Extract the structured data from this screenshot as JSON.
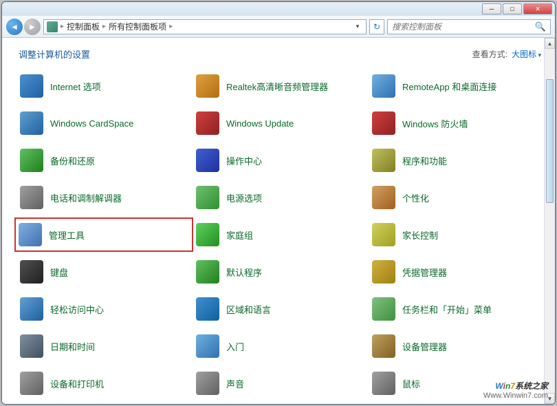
{
  "breadcrumb": {
    "root": "控制面板",
    "current": "所有控制面板项"
  },
  "search": {
    "placeholder": "搜索控制面板"
  },
  "page_title": "调整计算机的设置",
  "view_by_label": "查看方式:",
  "view_by_value": "大图标",
  "items": [
    {
      "label": "Internet 选项",
      "icon": "internet-options-icon",
      "cls": "ico1"
    },
    {
      "label": "Realtek高清晰音频管理器",
      "icon": "realtek-audio-icon",
      "cls": "ico2"
    },
    {
      "label": "RemoteApp 和桌面连接",
      "icon": "remoteapp-icon",
      "cls": "ico3"
    },
    {
      "label": "Windows CardSpace",
      "icon": "cardspace-icon",
      "cls": "ico4"
    },
    {
      "label": "Windows Update",
      "icon": "windows-update-icon",
      "cls": "ico5"
    },
    {
      "label": "Windows 防火墙",
      "icon": "firewall-icon",
      "cls": "ico5"
    },
    {
      "label": "备份和还原",
      "icon": "backup-restore-icon",
      "cls": "ico6"
    },
    {
      "label": "操作中心",
      "icon": "action-center-icon",
      "cls": "ico7"
    },
    {
      "label": "程序和功能",
      "icon": "programs-features-icon",
      "cls": "ico8"
    },
    {
      "label": "电话和调制解调器",
      "icon": "phone-modem-icon",
      "cls": "ico9"
    },
    {
      "label": "电源选项",
      "icon": "power-options-icon",
      "cls": "ico10"
    },
    {
      "label": "个性化",
      "icon": "personalization-icon",
      "cls": "ico11"
    },
    {
      "label": "管理工具",
      "icon": "admin-tools-icon",
      "cls": "ico12",
      "highlight": true
    },
    {
      "label": "家庭组",
      "icon": "homegroup-icon",
      "cls": "ico13"
    },
    {
      "label": "家长控制",
      "icon": "parental-controls-icon",
      "cls": "ico14"
    },
    {
      "label": "键盘",
      "icon": "keyboard-icon",
      "cls": "ico15"
    },
    {
      "label": "默认程序",
      "icon": "default-programs-icon",
      "cls": "ico16"
    },
    {
      "label": "凭据管理器",
      "icon": "credential-manager-icon",
      "cls": "ico17"
    },
    {
      "label": "轻松访问中心",
      "icon": "ease-of-access-icon",
      "cls": "ico18"
    },
    {
      "label": "区域和语言",
      "icon": "region-language-icon",
      "cls": "ico19"
    },
    {
      "label": "任务栏和「开始」菜单",
      "icon": "taskbar-start-icon",
      "cls": "ico20"
    },
    {
      "label": "日期和时间",
      "icon": "date-time-icon",
      "cls": "ico21"
    },
    {
      "label": "入门",
      "icon": "getting-started-icon",
      "cls": "ico22"
    },
    {
      "label": "设备管理器",
      "icon": "device-manager-icon",
      "cls": "ico23"
    },
    {
      "label": "设备和打印机",
      "icon": "devices-printers-icon",
      "cls": "ico24"
    },
    {
      "label": "声音",
      "icon": "sound-icon",
      "cls": "ico9"
    },
    {
      "label": "鼠标",
      "icon": "mouse-icon",
      "cls": "ico24"
    }
  ],
  "watermark": {
    "line1_brand": "Win7",
    "line1_rest": "系统之家",
    "line2": "Www.Winwin7.com"
  }
}
